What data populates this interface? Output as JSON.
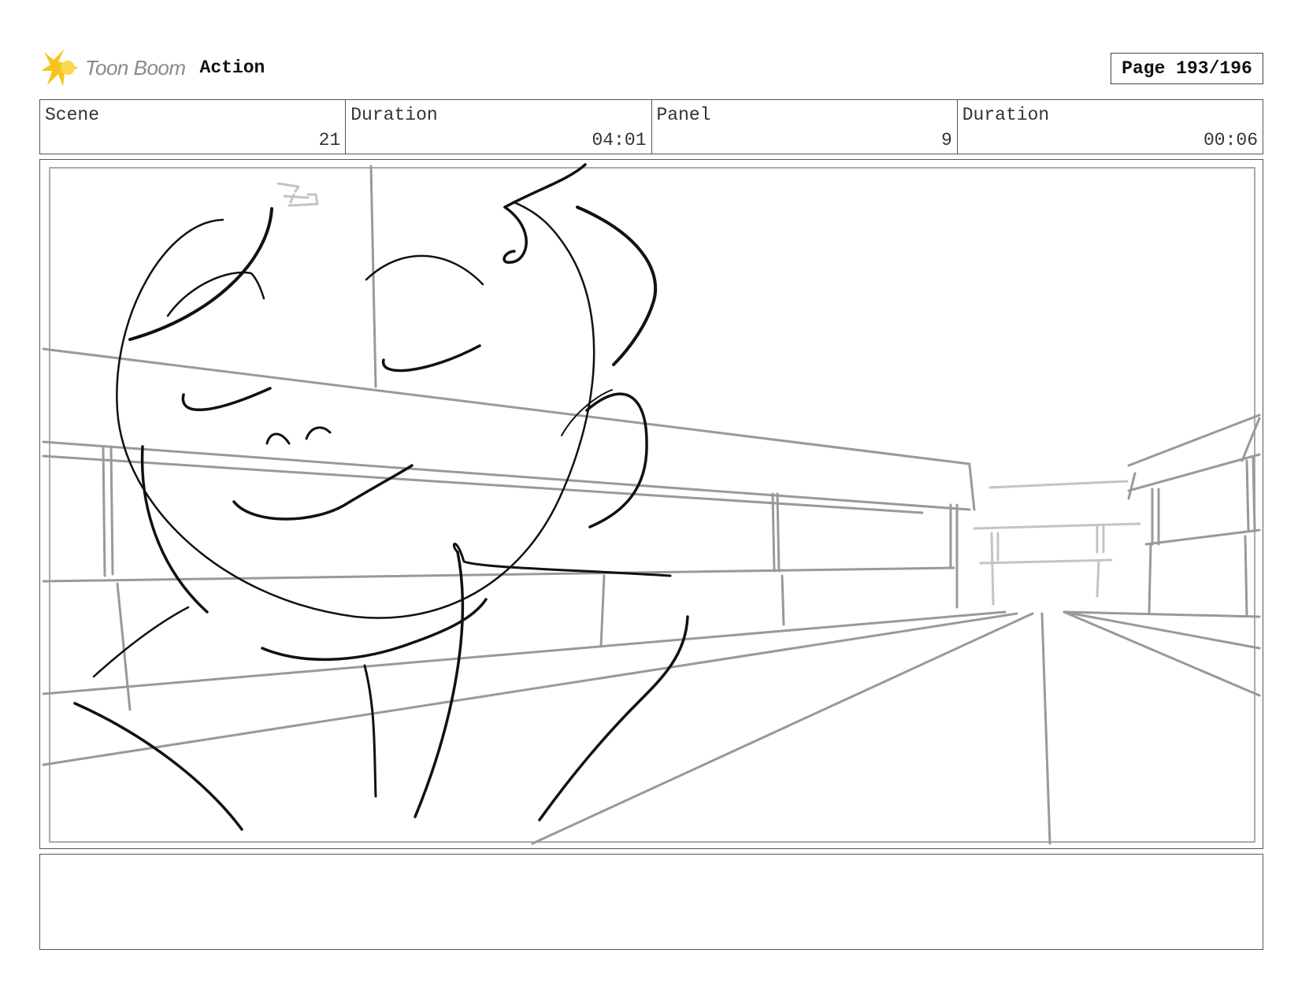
{
  "header": {
    "brand": "Toon Boom",
    "doc_type": "Action",
    "page": "Page 193/196"
  },
  "info": {
    "scene_label": "Scene",
    "scene_value": "21",
    "scene_duration_label": "Duration",
    "scene_duration_value": "04:01",
    "panel_label": "Panel",
    "panel_value": "9",
    "panel_duration_label": "Duration",
    "panel_duration_value": "00:06"
  },
  "colors": {
    "logo_yellow": "#f7c41f",
    "ink": "#111111",
    "guide": "#999999",
    "border": "#555555"
  },
  "notes": {
    "text": ""
  }
}
